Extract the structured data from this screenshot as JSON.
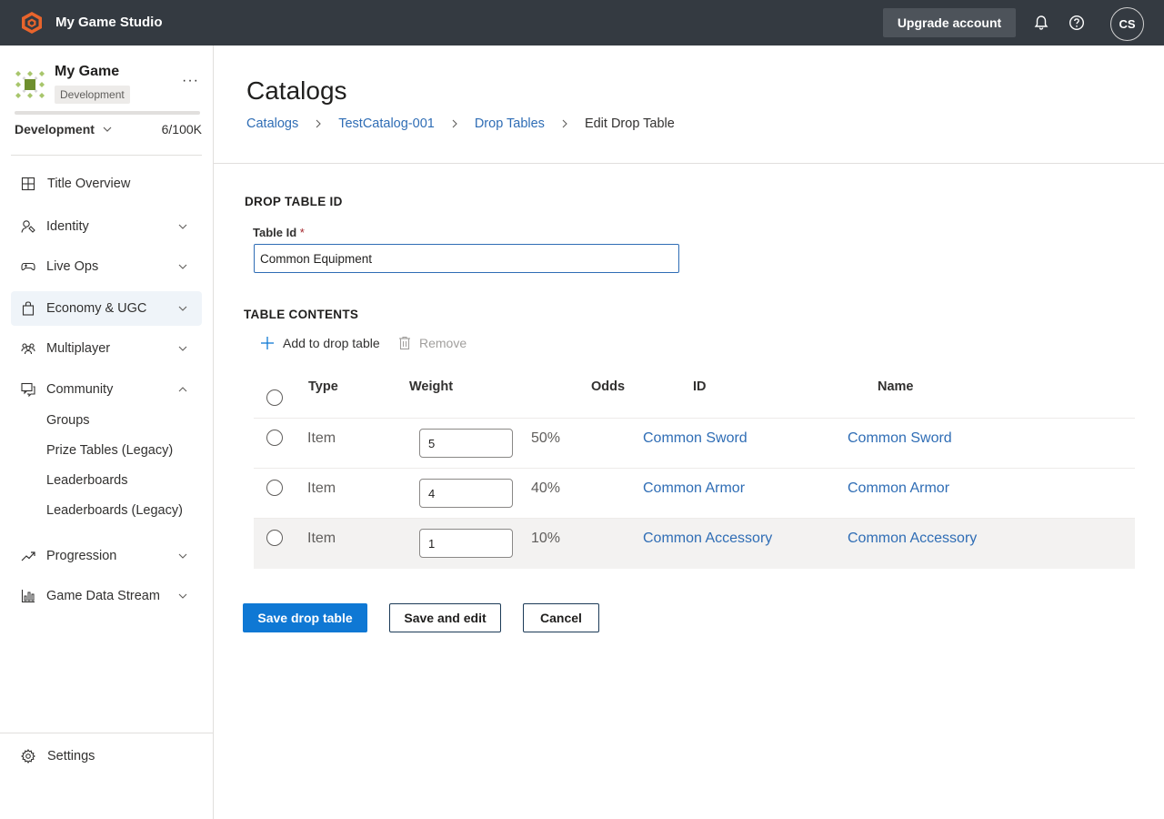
{
  "topbar": {
    "brand": "My Game Studio",
    "upgrade_label": "Upgrade account",
    "avatar_initials": "CS"
  },
  "sidebar": {
    "game_name": "My Game",
    "env_badge": "Development",
    "env_selected": "Development",
    "usage_text": "6/100K",
    "usage_fraction": 0.0,
    "items": [
      {
        "label": "Title Overview",
        "icon": "grid-icon"
      },
      {
        "label": "Identity",
        "icon": "identity-icon"
      },
      {
        "label": "Live Ops",
        "icon": "gamepad-icon"
      },
      {
        "label": "Economy & UGC",
        "icon": "bag-icon"
      },
      {
        "label": "Multiplayer",
        "icon": "people-icon"
      },
      {
        "label": "Community",
        "icon": "chat-icon"
      },
      {
        "label": "Progression",
        "icon": "trend-icon"
      },
      {
        "label": "Game Data Stream",
        "icon": "chart-icon"
      }
    ],
    "community_subitems": [
      "Groups",
      "Prize Tables (Legacy)",
      "Leaderboards",
      "Leaderboards (Legacy)"
    ],
    "settings_label": "Settings"
  },
  "main": {
    "title": "Catalogs",
    "breadcrumb": [
      "Catalogs",
      "TestCatalog-001",
      "Drop Tables",
      "Edit Drop Table"
    ],
    "section_id": "DROP TABLE ID",
    "table_id_label": "Table Id",
    "required_mark": "*",
    "table_id_value": "Common Equipment",
    "section_contents": "TABLE CONTENTS",
    "add_label": "Add to drop table",
    "remove_label": "Remove",
    "columns": [
      "Type",
      "Weight",
      "Odds",
      "ID",
      "Name"
    ],
    "rows": [
      {
        "type": "Item",
        "weight": "5",
        "odds": "50%",
        "id": "Common Sword",
        "name": "Common Sword"
      },
      {
        "type": "Item",
        "weight": "4",
        "odds": "40%",
        "id": "Common Armor",
        "name": "Common Armor"
      },
      {
        "type": "Item",
        "weight": "1",
        "odds": "10%",
        "id": "Common Accessory",
        "name": "Common Accessory"
      }
    ],
    "save_label": "Save drop table",
    "save_edit_label": "Save and edit",
    "cancel_label": "Cancel"
  },
  "colors": {
    "topbar": "#343a41",
    "brand_orange": "#e8642c",
    "link": "#2f6db5",
    "primary": "#0f78d4"
  }
}
